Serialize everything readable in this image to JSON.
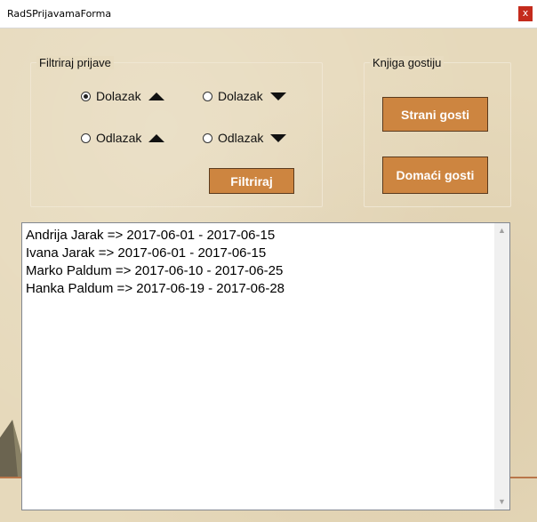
{
  "window": {
    "title": "RadSPrijavamaForma",
    "close_label": "x"
  },
  "filter_group": {
    "label": "Filtriraj prijave",
    "options": [
      {
        "label": "Dolazak",
        "direction": "up",
        "checked": true
      },
      {
        "label": "Dolazak",
        "direction": "down",
        "checked": false
      },
      {
        "label": "Odlazak",
        "direction": "up",
        "checked": false
      },
      {
        "label": "Odlazak",
        "direction": "down",
        "checked": false
      }
    ],
    "filter_button": "Filtriraj"
  },
  "guestbook_group": {
    "label": "Knjiga gostiju",
    "foreign_button": "Strani gosti",
    "domestic_button": "Domaći gosti"
  },
  "list": {
    "items": [
      "Andrija Jarak => 2017-06-01 - 2017-06-15",
      "Ivana Jarak => 2017-06-01 - 2017-06-15",
      "Marko Paldum => 2017-06-10 - 2017-06-25",
      "Hanka Paldum => 2017-06-19 - 2017-06-28"
    ]
  },
  "colors": {
    "button": "#cd8540",
    "background": "#e6d9bb",
    "close": "#c42b1c"
  }
}
